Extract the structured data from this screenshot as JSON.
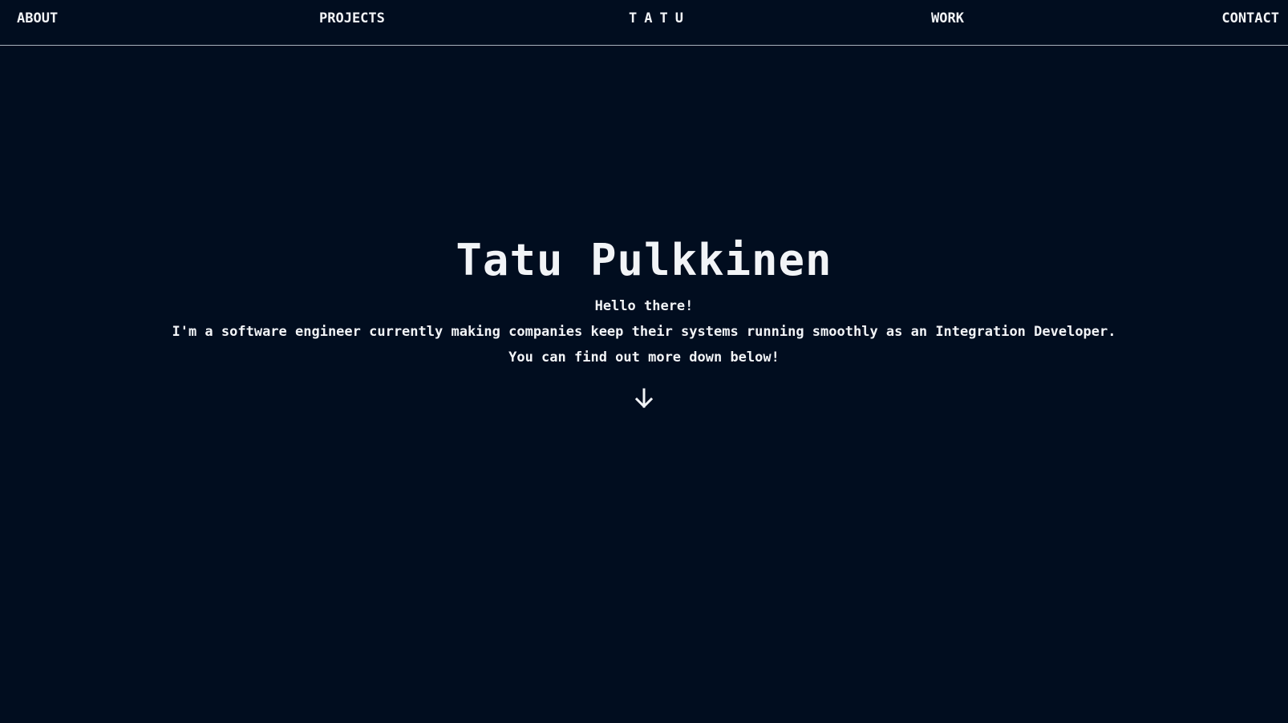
{
  "nav": {
    "about": "ABOUT",
    "projects": "PROJECTS",
    "brand": "TATU",
    "work": "WORK",
    "contact": "CONTACT"
  },
  "hero": {
    "title": "Tatu Pulkkinen",
    "lines": [
      "Hello there!",
      "I'm a software engineer currently making companies keep their systems running smoothly as an Integration Developer.",
      "You can find out more down below!"
    ],
    "scroll_icon": "arrow-down-icon"
  },
  "colors": {
    "background": "#010d1f",
    "text": "#f2f4f7",
    "divider": "#a9b1bd"
  }
}
